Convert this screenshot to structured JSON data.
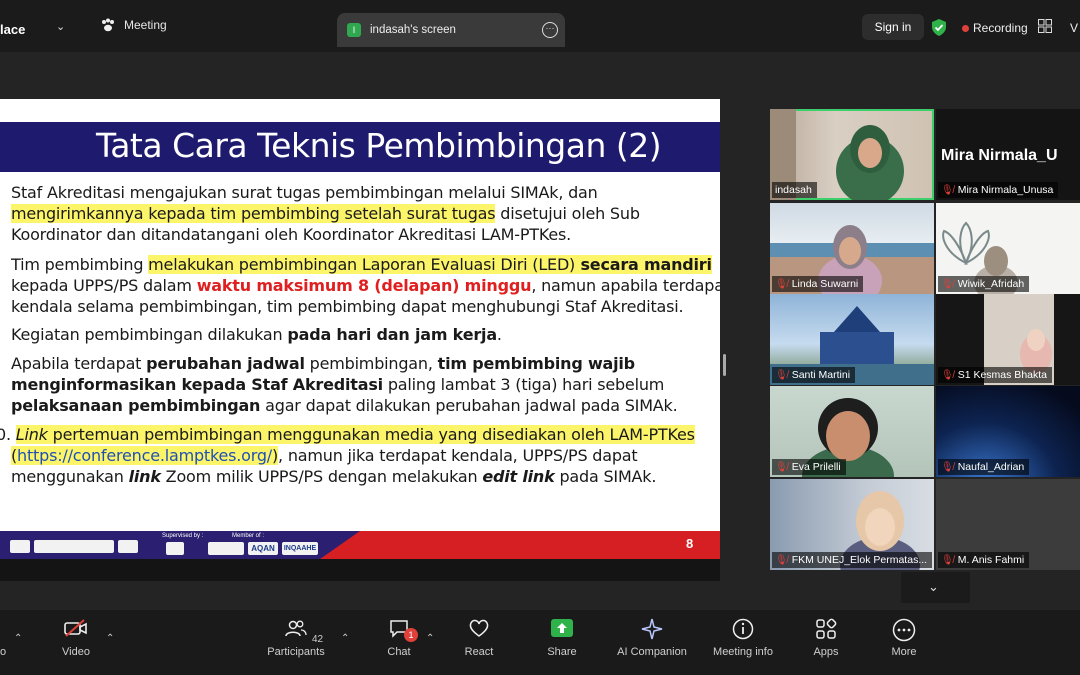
{
  "topbar": {
    "app_name": "lace",
    "meeting_label": "Meeting",
    "tab_label": "indasah's screen",
    "tab_icon_letter": "I",
    "signin_label": "Sign in",
    "recording_label": "Recording",
    "right_cut": "V"
  },
  "slide": {
    "title": "Tata Cara Teknis Pembimbingan (2)",
    "page_number": "8",
    "footer_supervised": "Supervised by :",
    "footer_member": "Member of :",
    "footer_logos": [
      "AQAN",
      "INQAAHE"
    ],
    "paragraphs": {
      "p1_a": "Staf Akreditasi mengajukan surat tugas pembimbingan melalui SIMAk, dan",
      "p1_b": "mengirimkannya kepada tim pembimbing setelah surat tugas",
      "p1_c": " disetujui oleh Sub",
      "p1_d": "Koordinator dan ditandatangani oleh Koordinator Akreditasi LAM-PTKes.",
      "p2_a": "Tim pembimbing ",
      "p2_b": "melakukan pembimbingan Laporan Evaluasi Diri (LED)",
      "p2_c": " secara mandiri",
      "p2_d": "kepada UPPS/PS dalam ",
      "p2_e": "waktu maksimum 8 (delapan) minggu",
      "p2_f": ", namun apabila terdapat",
      "p2_g": "kendala selama pembimbingan, tim pembimbing dapat menghubungi Staf Akreditasi.",
      "p3_a": "Kegiatan pembimbingan dilakukan ",
      "p3_b": "pada hari dan jam kerja",
      "p3_c": ".",
      "p4_a": "Apabila terdapat ",
      "p4_b": "perubahan jadwal",
      "p4_c": " pembimbingan, ",
      "p4_d": "tim pembimbing wajib",
      "p4_e": "menginformasikan kepada Staf Akreditasi",
      "p4_f": " paling lambat 3 (tiga) hari sebelum",
      "p4_g": "pelaksanaan pembimbingan",
      "p4_h": " agar dapat dilakukan perubahan jadwal pada SIMAk.",
      "p5_num": "0.",
      "p5_a": "Link",
      "p5_b": " pertemuan pembimbingan menggunakan media yang disediakan oleh LAM-PTKes",
      "p5_c": "(",
      "p5_d": "https://conference.lamptkes.org/",
      "p5_e": ")",
      "p5_f": ", namun jika terdapat kendala, UPPS/PS dapat",
      "p5_g": "menggunakan ",
      "p5_h": "link",
      "p5_i": " Zoom milik UPPS/PS dengan melakukan ",
      "p5_j": "edit link",
      "p5_k": " pada SIMAk."
    }
  },
  "participants": [
    {
      "name": "indasah",
      "muted": false
    },
    {
      "name": "Mira Nirmala_Unusa",
      "big": "Mira  Nirmala_U",
      "muted": true
    },
    {
      "name": "Linda Suwarni",
      "muted": true
    },
    {
      "name": "Wiwik_Afridah",
      "muted": true
    },
    {
      "name": "Santi Martini",
      "muted": true
    },
    {
      "name": "S1 Kesmas Bhakta",
      "muted": true
    },
    {
      "name": "Eva Prilelli",
      "muted": true
    },
    {
      "name": "Naufal_Adrian",
      "muted": true
    },
    {
      "name": "FKM UNEJ_Elok Permatas...",
      "muted": true
    },
    {
      "name": "M. Anis Fahmi",
      "muted": true
    }
  ],
  "toolbar": {
    "audio_cut": "o",
    "video": "Video",
    "participants": "Participants",
    "participants_count": "42",
    "chat": "Chat",
    "chat_badge": "1",
    "react": "React",
    "share": "Share",
    "ai_companion": "AI Companion",
    "meeting_info": "Meeting info",
    "apps": "Apps",
    "more": "More"
  },
  "colors": {
    "accent_green": "#3ccf6a",
    "record_red": "#e0403a",
    "slide_header": "#1e1a6e",
    "highlight": "#fcf56a"
  }
}
